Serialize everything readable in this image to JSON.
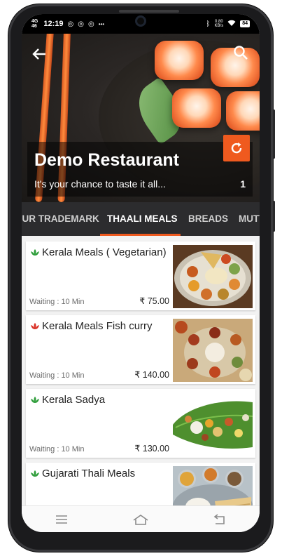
{
  "status_bar": {
    "network_top": "4G",
    "network_bottom": "46",
    "time": "12:19",
    "data_speed_top": "0.80",
    "data_speed_bottom": "KB/s",
    "battery": "84",
    "notification_overflow": "•••"
  },
  "header": {
    "restaurant_name": "Demo Restaurant",
    "tagline": "It's your chance to taste it all...",
    "count": "1"
  },
  "tabs": [
    {
      "label": "OUR TRADEMARK"
    },
    {
      "label": "THAALI MEALS",
      "active": true
    },
    {
      "label": "BREADS"
    },
    {
      "label": "MUTTON"
    }
  ],
  "menu_items": [
    {
      "name": "Kerala Meals ( Vegetarian)",
      "diet": "veg",
      "waiting": "Waiting : 10 Min",
      "price": "₹ 75.00"
    },
    {
      "name": "Kerala Meals Fish curry",
      "diet": "non-veg",
      "waiting": "Waiting : 10 Min",
      "price": "₹ 140.00"
    },
    {
      "name": "Kerala Sadya",
      "diet": "veg",
      "waiting": "Waiting : 10 Min",
      "price": "₹ 130.00"
    },
    {
      "name": "Gujarati Thali Meals",
      "diet": "veg",
      "waiting": "",
      "price": ""
    }
  ],
  "colors": {
    "accent": "#ef5a1f",
    "tab_bar": "#2c2c2e",
    "veg_mark": "#2e9d3a",
    "nonveg_mark": "#d93025"
  },
  "icons": {
    "back": "arrow-left",
    "search": "magnifier",
    "refresh": "refresh",
    "veg": "leaf-mark",
    "nonveg": "leaf-mark"
  }
}
